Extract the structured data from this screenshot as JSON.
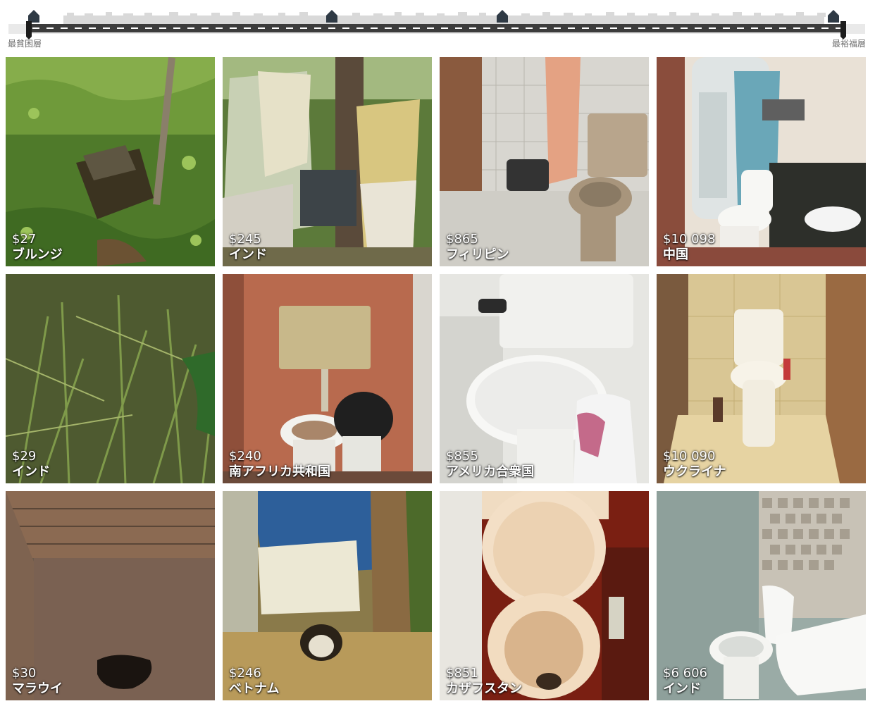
{
  "street": {
    "label_left": "最貧困層",
    "label_right": "最裕福層"
  },
  "colors": {
    "street_road": "#3c3c3c",
    "street_houses": "#d6d6d6",
    "street_marker": "#2f3a45",
    "caption_text": "#ffffff"
  },
  "tiles": [
    {
      "income": "$27",
      "country": "ブルンジ",
      "scene": "grass-pit"
    },
    {
      "income": "$245",
      "country": "インド",
      "scene": "cloth-shelter"
    },
    {
      "income": "$865",
      "country": "フィリピン",
      "scene": "tiled-bathroom"
    },
    {
      "income": "$10 098",
      "country": "中国",
      "scene": "modern-bathroom"
    },
    {
      "income": "$29",
      "country": "インド",
      "scene": "tall-grass"
    },
    {
      "income": "$240",
      "country": "南アフリカ共和国",
      "scene": "brick-wall-toilet"
    },
    {
      "income": "$855",
      "country": "アメリカ合衆国",
      "scene": "white-toilet"
    },
    {
      "income": "$10 090",
      "country": "ウクライナ",
      "scene": "beige-tiled-toilet"
    },
    {
      "income": "$30",
      "country": "マラウイ",
      "scene": "stone-pit"
    },
    {
      "income": "$246",
      "country": "ベトナム",
      "scene": "tarp-shelter"
    },
    {
      "income": "$851",
      "country": "カザフスタン",
      "scene": "open-toilet"
    },
    {
      "income": "$6 606",
      "country": "インド",
      "scene": "mosaic-bathroom"
    }
  ]
}
